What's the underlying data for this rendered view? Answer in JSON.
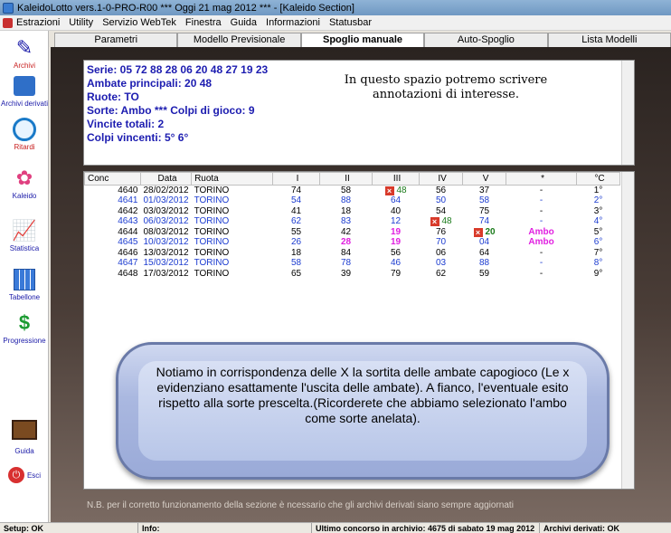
{
  "window": {
    "title": "KaleidoLotto vers.1-0-PRO-R00  ***  Oggi 21 mag 2012  ***  - [Kaleido Section]"
  },
  "menu": [
    "Estrazioni",
    "Utility",
    "Servizio WebTek",
    "Finestra",
    "Guida",
    "Informazioni",
    "Statusbar"
  ],
  "toolbar": {
    "archivi": "Archivi",
    "archivi_derivati": "Archivi derivati",
    "ritardi": "Ritardi",
    "kaleido": "Kaleido",
    "statistica": "Statistica",
    "tabellone": "Tabellone",
    "progressione": "Progressione",
    "guida": "Guida",
    "esci": "Esci"
  },
  "tabs": [
    "Parametri",
    "Modello Previsionale",
    "Spoglio manuale",
    "Auto-Spoglio",
    "Lista Modelli"
  ],
  "notes": {
    "series": "Serie: 05 72 88 28 06 20 48 27 19 23",
    "ambate": "Ambate principali: 20 48",
    "ruote": "Ruote: TO",
    "sorte": "Sorte: Ambo *** Colpi di gioco: 9",
    "vincite": "Vincite totali: 2",
    "colpi": "Colpi vincenti: 5° 6°",
    "annotation_line1": "In questo spazio potremo scrivere",
    "annotation_line2": "annotazioni di interesse."
  },
  "table": {
    "headers": [
      "Conc",
      "Data",
      "Ruota",
      "I",
      "II",
      "III",
      "IV",
      "V",
      "*",
      "°C"
    ],
    "rows": [
      {
        "conc": "4640",
        "data": "28/02/2012",
        "ruota": "TORINO",
        "n1": "74",
        "n2": "58",
        "n3": "48",
        "n4": "56",
        "n5": "37",
        "esito": "-",
        "colpo": "1°"
      },
      {
        "conc": "4641",
        "data": "01/03/2012",
        "ruota": "TORINO",
        "n1": "54",
        "n2": "88",
        "n3": "64",
        "n4": "50",
        "n5": "58",
        "esito": "-",
        "colpo": "2°"
      },
      {
        "conc": "4642",
        "data": "03/03/2012",
        "ruota": "TORINO",
        "n1": "41",
        "n2": "18",
        "n3": "40",
        "n4": "54",
        "n5": "75",
        "esito": "-",
        "colpo": "3°"
      },
      {
        "conc": "4643",
        "data": "06/03/2012",
        "ruota": "TORINO",
        "n1": "62",
        "n2": "83",
        "n3": "12",
        "n4": "48",
        "n5": "74",
        "esito": "-",
        "colpo": "4°"
      },
      {
        "conc": "4644",
        "data": "08/03/2012",
        "ruota": "TORINO",
        "n1": "55",
        "n2": "42",
        "n3": "19",
        "n4": "76",
        "n5": "20",
        "esito": "Ambo",
        "colpo": "5°"
      },
      {
        "conc": "4645",
        "data": "10/03/2012",
        "ruota": "TORINO",
        "n1": "26",
        "n2": "28",
        "n3": "19",
        "n4": "70",
        "n5": "04",
        "esito": "Ambo",
        "colpo": "6°"
      },
      {
        "conc": "4646",
        "data": "13/03/2012",
        "ruota": "TORINO",
        "n1": "18",
        "n2": "84",
        "n3": "56",
        "n4": "06",
        "n5": "64",
        "esito": "-",
        "colpo": "7°"
      },
      {
        "conc": "4647",
        "data": "15/03/2012",
        "ruota": "TORINO",
        "n1": "58",
        "n2": "78",
        "n3": "46",
        "n4": "03",
        "n5": "88",
        "esito": "-",
        "colpo": "8°"
      },
      {
        "conc": "4648",
        "data": "17/03/2012",
        "ruota": "TORINO",
        "n1": "65",
        "n2": "39",
        "n3": "79",
        "n4": "62",
        "n5": "59",
        "esito": "-",
        "colpo": "9°"
      }
    ]
  },
  "callout": {
    "text": "Notiamo in corrispondenza delle X la sortita delle ambate capogioco (Le x evidenziano esattamente l'uscita delle ambate). A fianco, l'eventuale esito rispetto alla sorte prescelta.(Ricorderete che abbiamo selezionato l'ambo come sorte anelata)."
  },
  "footnote": "N.B. per il corretto funzionamento della sezione è ncessario che gli archivi derivati siano sempre aggiornati",
  "statusbar": {
    "setup": "Setup: OK",
    "info": "Info:",
    "ultimo": "Ultimo concorso in archivio: 4675 di sabato 19 mag 2012",
    "derivati": "Archivi derivati: OK"
  },
  "colors": {
    "accent_blue": "#1c3cd0",
    "hit_magenta": "#e020e0",
    "mark_red": "#d83a2a"
  }
}
